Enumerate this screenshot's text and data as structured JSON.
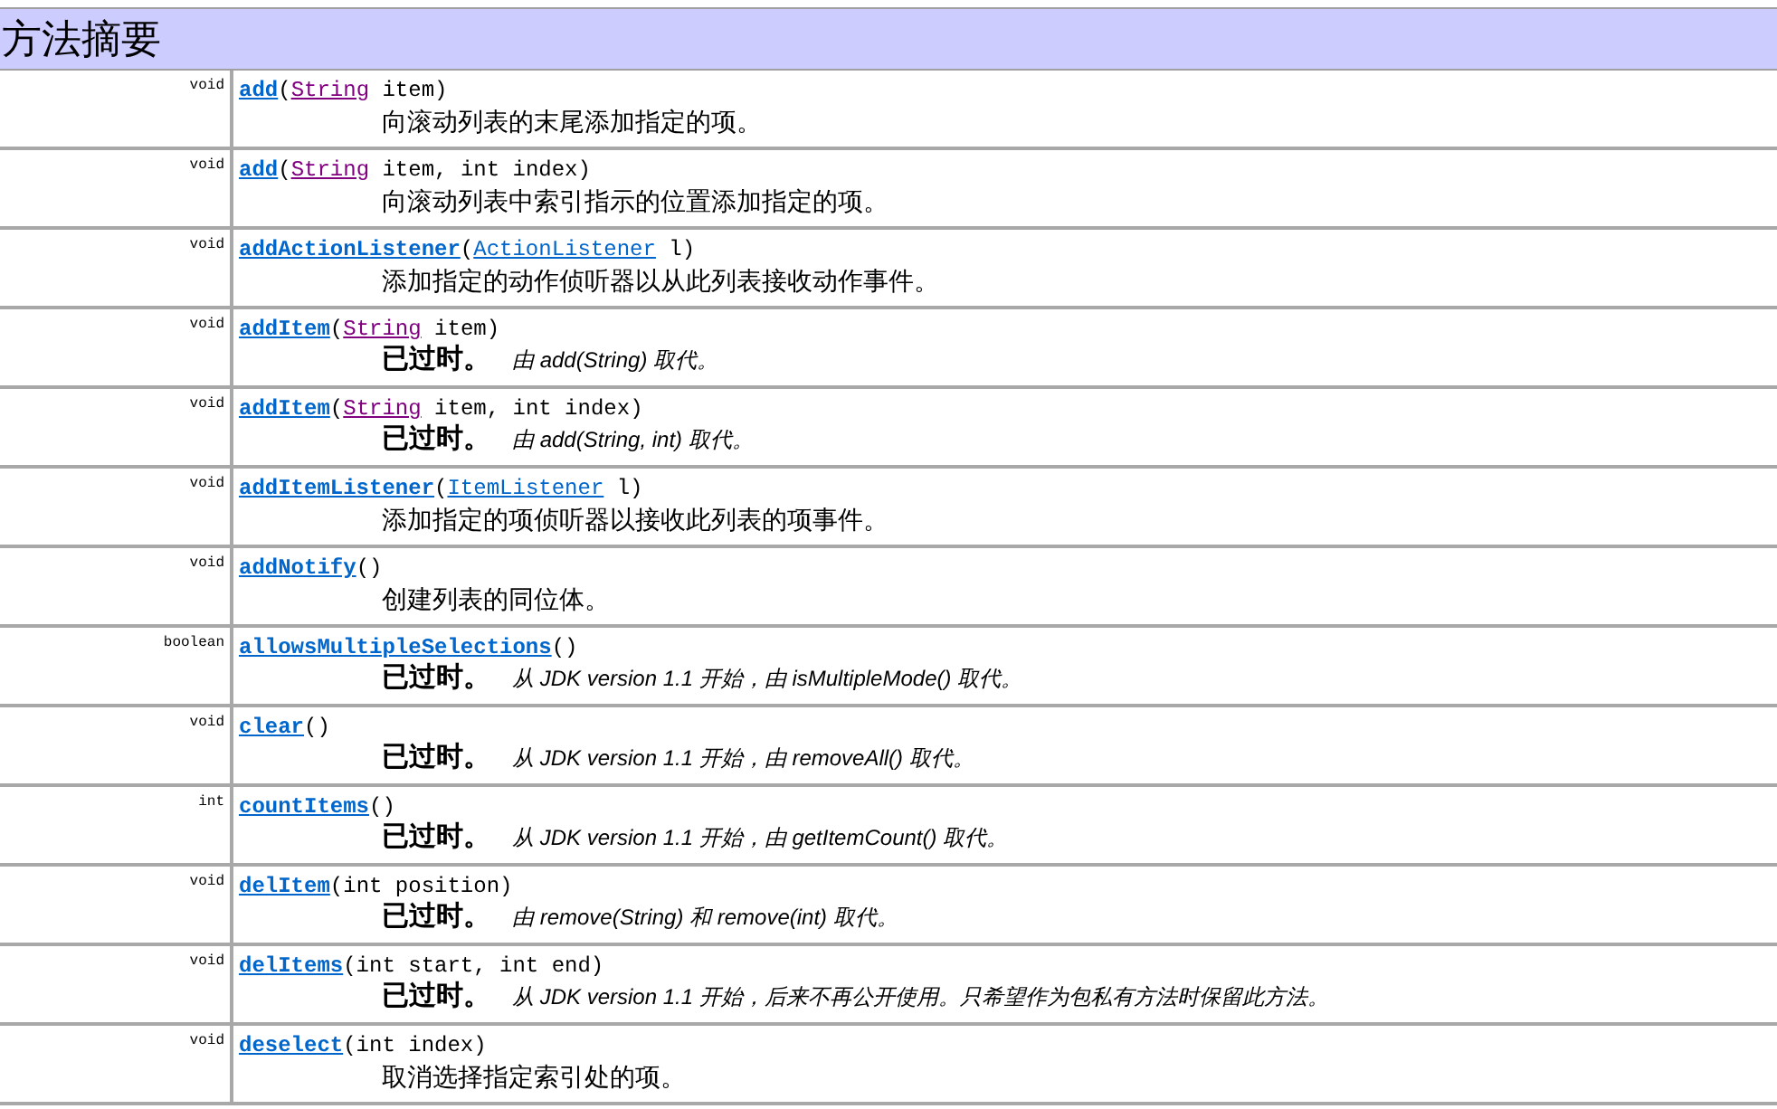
{
  "title": "方法摘要",
  "rows": [
    {
      "return_type": "void",
      "method": "add",
      "params": [
        {
          "kind": "text",
          "text": "("
        },
        {
          "kind": "link",
          "text": "String",
          "visited": true
        },
        {
          "kind": "text",
          "text": " item)"
        }
      ],
      "description": {
        "kind": "plain",
        "text": "向滚动列表的末尾添加指定的项。"
      }
    },
    {
      "return_type": "void",
      "method": "add",
      "params": [
        {
          "kind": "text",
          "text": "("
        },
        {
          "kind": "link",
          "text": "String",
          "visited": true
        },
        {
          "kind": "text",
          "text": " item, int index)"
        }
      ],
      "description": {
        "kind": "plain",
        "text": "向滚动列表中索引指示的位置添加指定的项。"
      }
    },
    {
      "return_type": "void",
      "method": "addActionListener",
      "params": [
        {
          "kind": "text",
          "text": "("
        },
        {
          "kind": "link",
          "text": "ActionListener",
          "visited": false
        },
        {
          "kind": "text",
          "text": " l)"
        }
      ],
      "description": {
        "kind": "plain",
        "text": "添加指定的动作侦听器以从此列表接收动作事件。"
      }
    },
    {
      "return_type": "void",
      "method": "addItem",
      "params": [
        {
          "kind": "text",
          "text": "("
        },
        {
          "kind": "link",
          "text": "String",
          "visited": true
        },
        {
          "kind": "text",
          "text": " item)"
        }
      ],
      "description": {
        "kind": "deprecated",
        "label": "已过时。",
        "note": "由 add(String) 取代。"
      }
    },
    {
      "return_type": "void",
      "method": "addItem",
      "params": [
        {
          "kind": "text",
          "text": "("
        },
        {
          "kind": "link",
          "text": "String",
          "visited": true
        },
        {
          "kind": "text",
          "text": " item, int index)"
        }
      ],
      "description": {
        "kind": "deprecated",
        "label": "已过时。",
        "note": "由 add(String, int) 取代。"
      }
    },
    {
      "return_type": "void",
      "method": "addItemListener",
      "params": [
        {
          "kind": "text",
          "text": "("
        },
        {
          "kind": "link",
          "text": "ItemListener",
          "visited": false
        },
        {
          "kind": "text",
          "text": " l)"
        }
      ],
      "description": {
        "kind": "plain",
        "text": "添加指定的项侦听器以接收此列表的项事件。"
      }
    },
    {
      "return_type": "void",
      "method": "addNotify",
      "params": [
        {
          "kind": "text",
          "text": "()"
        }
      ],
      "description": {
        "kind": "plain",
        "text": "创建列表的同位体。"
      }
    },
    {
      "return_type": "boolean",
      "method": "allowsMultipleSelections",
      "params": [
        {
          "kind": "text",
          "text": "()"
        }
      ],
      "description": {
        "kind": "deprecated",
        "label": "已过时。",
        "note": "从 JDK version 1.1 开始，由 isMultipleMode() 取代。"
      }
    },
    {
      "return_type": "void",
      "method": "clear",
      "params": [
        {
          "kind": "text",
          "text": "()"
        }
      ],
      "description": {
        "kind": "deprecated",
        "label": "已过时。",
        "note": "从 JDK version 1.1 开始，由 removeAll() 取代。"
      }
    },
    {
      "return_type": "int",
      "method": "countItems",
      "params": [
        {
          "kind": "text",
          "text": "()"
        }
      ],
      "description": {
        "kind": "deprecated",
        "label": "已过时。",
        "note": "从 JDK version 1.1 开始，由 getItemCount() 取代。"
      }
    },
    {
      "return_type": "void",
      "method": "delItem",
      "params": [
        {
          "kind": "text",
          "text": "(int position)"
        }
      ],
      "description": {
        "kind": "deprecated",
        "label": "已过时。",
        "note": "由 remove(String) 和 remove(int) 取代。"
      }
    },
    {
      "return_type": "void",
      "method": "delItems",
      "params": [
        {
          "kind": "text",
          "text": "(int start, int end)"
        }
      ],
      "description": {
        "kind": "deprecated",
        "label": "已过时。",
        "note": "从 JDK version 1.1 开始，后来不再公开使用。只希望作为包私有方法时保留此方法。"
      }
    },
    {
      "return_type": "void",
      "method": "deselect",
      "params": [
        {
          "kind": "text",
          "text": "(int index)"
        }
      ],
      "description": {
        "kind": "plain",
        "text": "取消选择指定索引处的项。"
      }
    }
  ]
}
